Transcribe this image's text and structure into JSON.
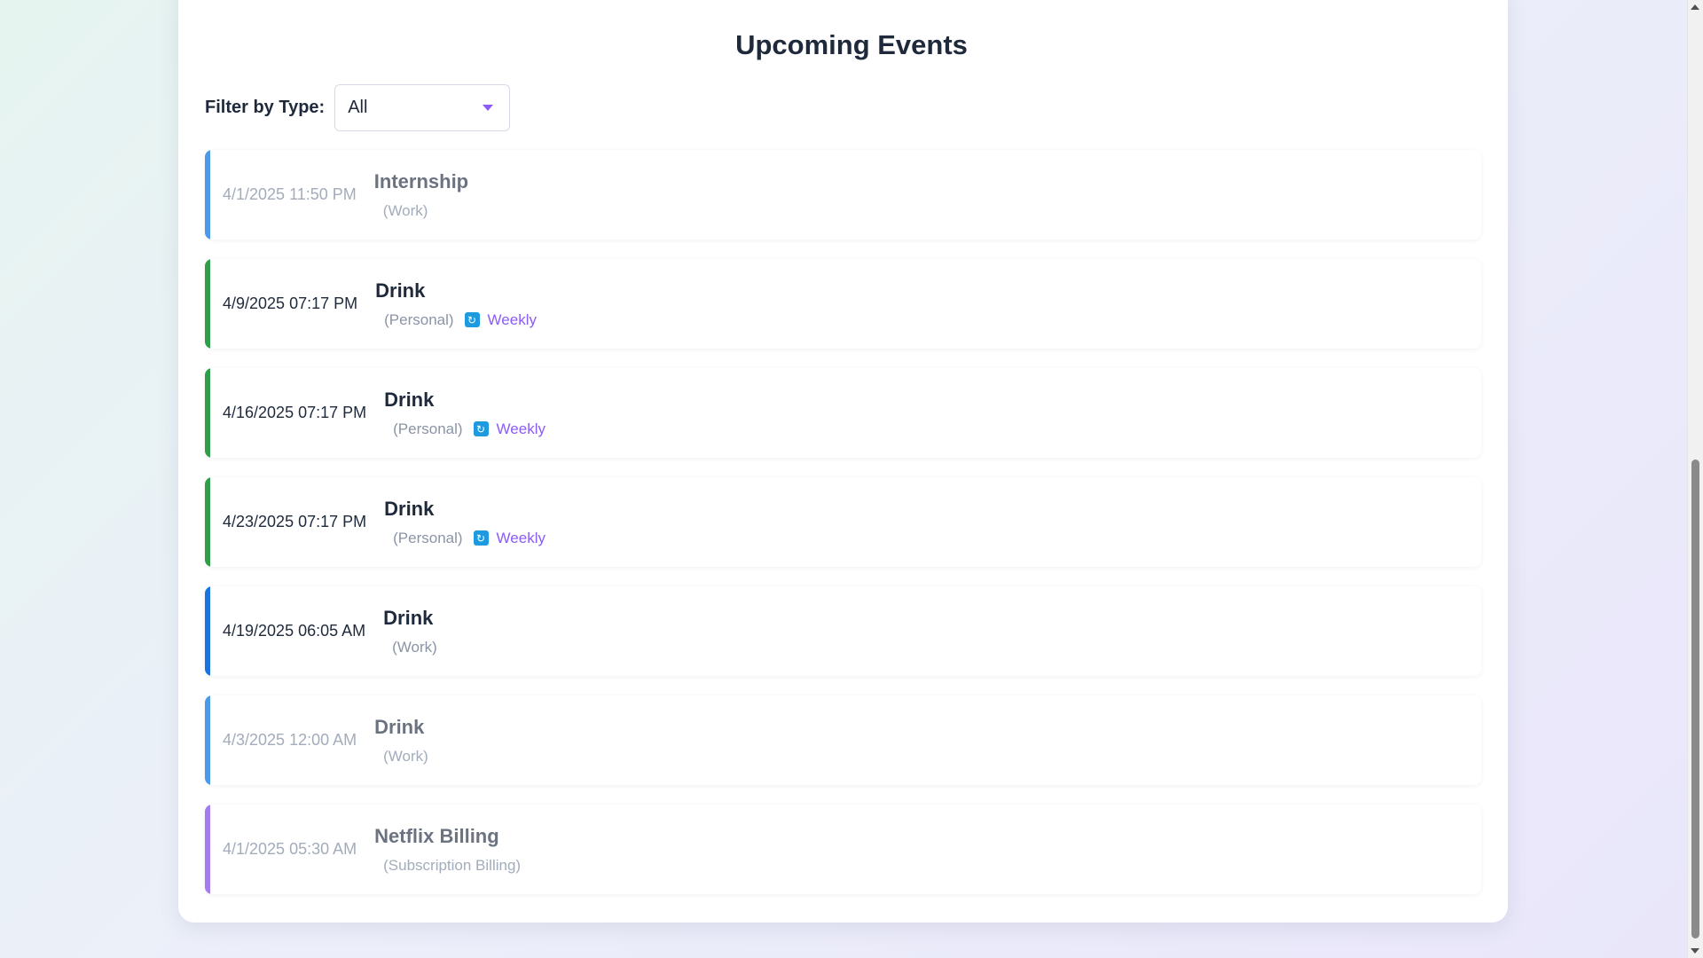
{
  "page": {
    "title": "Upcoming Events"
  },
  "filter": {
    "label": "Filter by Type:",
    "selected": "All"
  },
  "events": [
    {
      "date": "4/1/2025 11:50 PM",
      "name": "Internship",
      "type": "(Work)",
      "recurrence": null,
      "accent": "#4a9ae8",
      "past": true
    },
    {
      "date": "4/9/2025 07:17 PM",
      "name": "Drink",
      "type": "(Personal)",
      "recurrence": "Weekly",
      "accent": "#2e9e4a",
      "past": false
    },
    {
      "date": "4/16/2025 07:17 PM",
      "name": "Drink",
      "type": "(Personal)",
      "recurrence": "Weekly",
      "accent": "#2e9e4a",
      "past": false
    },
    {
      "date": "4/23/2025 07:17 PM",
      "name": "Drink",
      "type": "(Personal)",
      "recurrence": "Weekly",
      "accent": "#2e9e4a",
      "past": false
    },
    {
      "date": "4/19/2025 06:05 AM",
      "name": "Drink",
      "type": "(Work)",
      "recurrence": null,
      "accent": "#1a73e0",
      "past": false
    },
    {
      "date": "4/3/2025 12:00 AM",
      "name": "Drink",
      "type": "(Work)",
      "recurrence": null,
      "accent": "#4a9ae8",
      "past": true
    },
    {
      "date": "4/1/2025 05:30 AM",
      "name": "Netflix Billing",
      "type": "(Subscription Billing)",
      "recurrence": null,
      "accent": "#a47cf0",
      "past": true
    }
  ],
  "icons": {
    "recurrence": "repeat-icon",
    "dropdown": "chevron-down-icon"
  },
  "colors": {
    "recurrence_label": "#8b5cf6",
    "recurrence_icon_bg": "#1e9be0"
  }
}
